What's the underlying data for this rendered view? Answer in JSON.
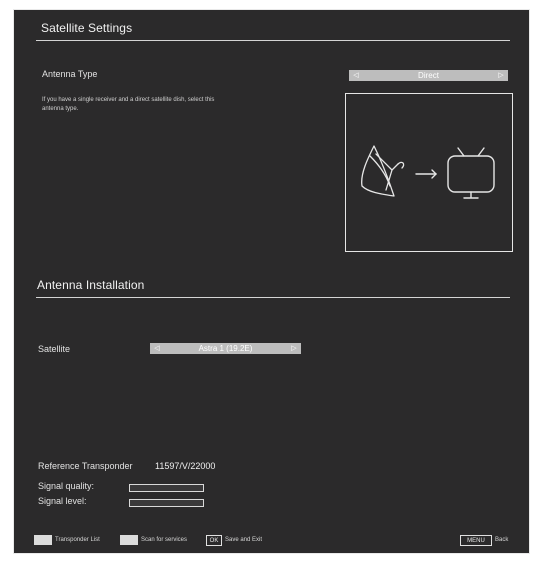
{
  "satellite_settings": {
    "title": "Satellite Settings",
    "antenna_type_label": "Antenna Type",
    "antenna_type_value": "Direct",
    "description": "If you have a single receiver and a direct satellite dish, select this antenna type."
  },
  "antenna_installation": {
    "title": "Antenna Installation",
    "satellite_label": "Satellite",
    "satellite_value": "Astra 1 (19.2E)",
    "reference_transponder_label": "Reference Transponder",
    "reference_transponder_value": "11597/V/22000",
    "signal_quality_label": "Signal quality:",
    "signal_level_label": "Signal level:",
    "signal_quality_percent": 0,
    "signal_level_percent": 0
  },
  "footer": {
    "transponder_list": "Transponder List",
    "scan_services": "Scan for services",
    "ok_key": "OK",
    "save_exit": "Save and Exit",
    "menu_key": "MENU",
    "back": "Back"
  },
  "colors": {
    "panel_bg": "#2b2a2b",
    "selector_bg": "#bdbdbd",
    "text": "#e6e6e6"
  },
  "icons": {
    "left_arrow": "left-arrow-icon",
    "right_arrow": "right-arrow-icon",
    "dish": "satellite-dish-icon",
    "arrow": "arrow-right-icon",
    "tv": "tv-icon"
  }
}
